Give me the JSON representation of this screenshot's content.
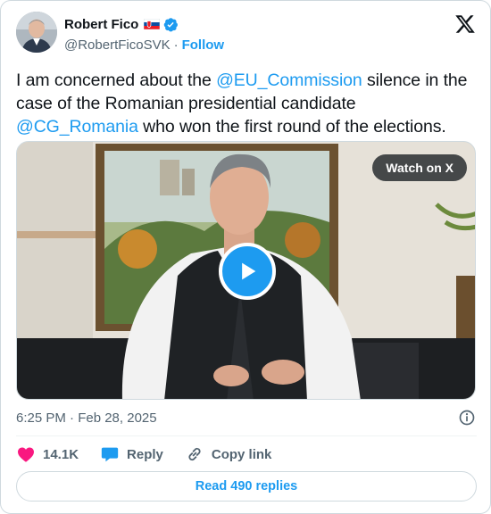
{
  "author": {
    "name": "Robert Fico",
    "handle": "@RobertFicoSVK",
    "follow_label": "Follow",
    "separator": "·"
  },
  "tweet": {
    "text_parts": [
      "I am concerned about the ",
      "@EU_Commission",
      " silence in the case of the Romanian presidential candidate ",
      "@CG_Romania",
      " who won the first round of the elections."
    ]
  },
  "media": {
    "watch_label": "Watch on X"
  },
  "meta": {
    "timestamp": "6:25 PM · Feb 28, 2025"
  },
  "actions": {
    "likes": "14.1K",
    "reply_label": "Reply",
    "copy_link_label": "Copy link"
  },
  "read_replies_label": "Read 490 replies",
  "icons": {
    "flag": "slovakia-flag-icon",
    "verified": "verified-badge-icon",
    "brand": "x-logo-icon",
    "play": "play-icon",
    "info": "info-icon",
    "like": "heart-icon",
    "reply": "speech-bubble-icon",
    "copy": "link-icon"
  },
  "colors": {
    "accent": "#1d9bf0",
    "like": "#f91880",
    "text": "#0f1419",
    "secondary": "#536471"
  }
}
